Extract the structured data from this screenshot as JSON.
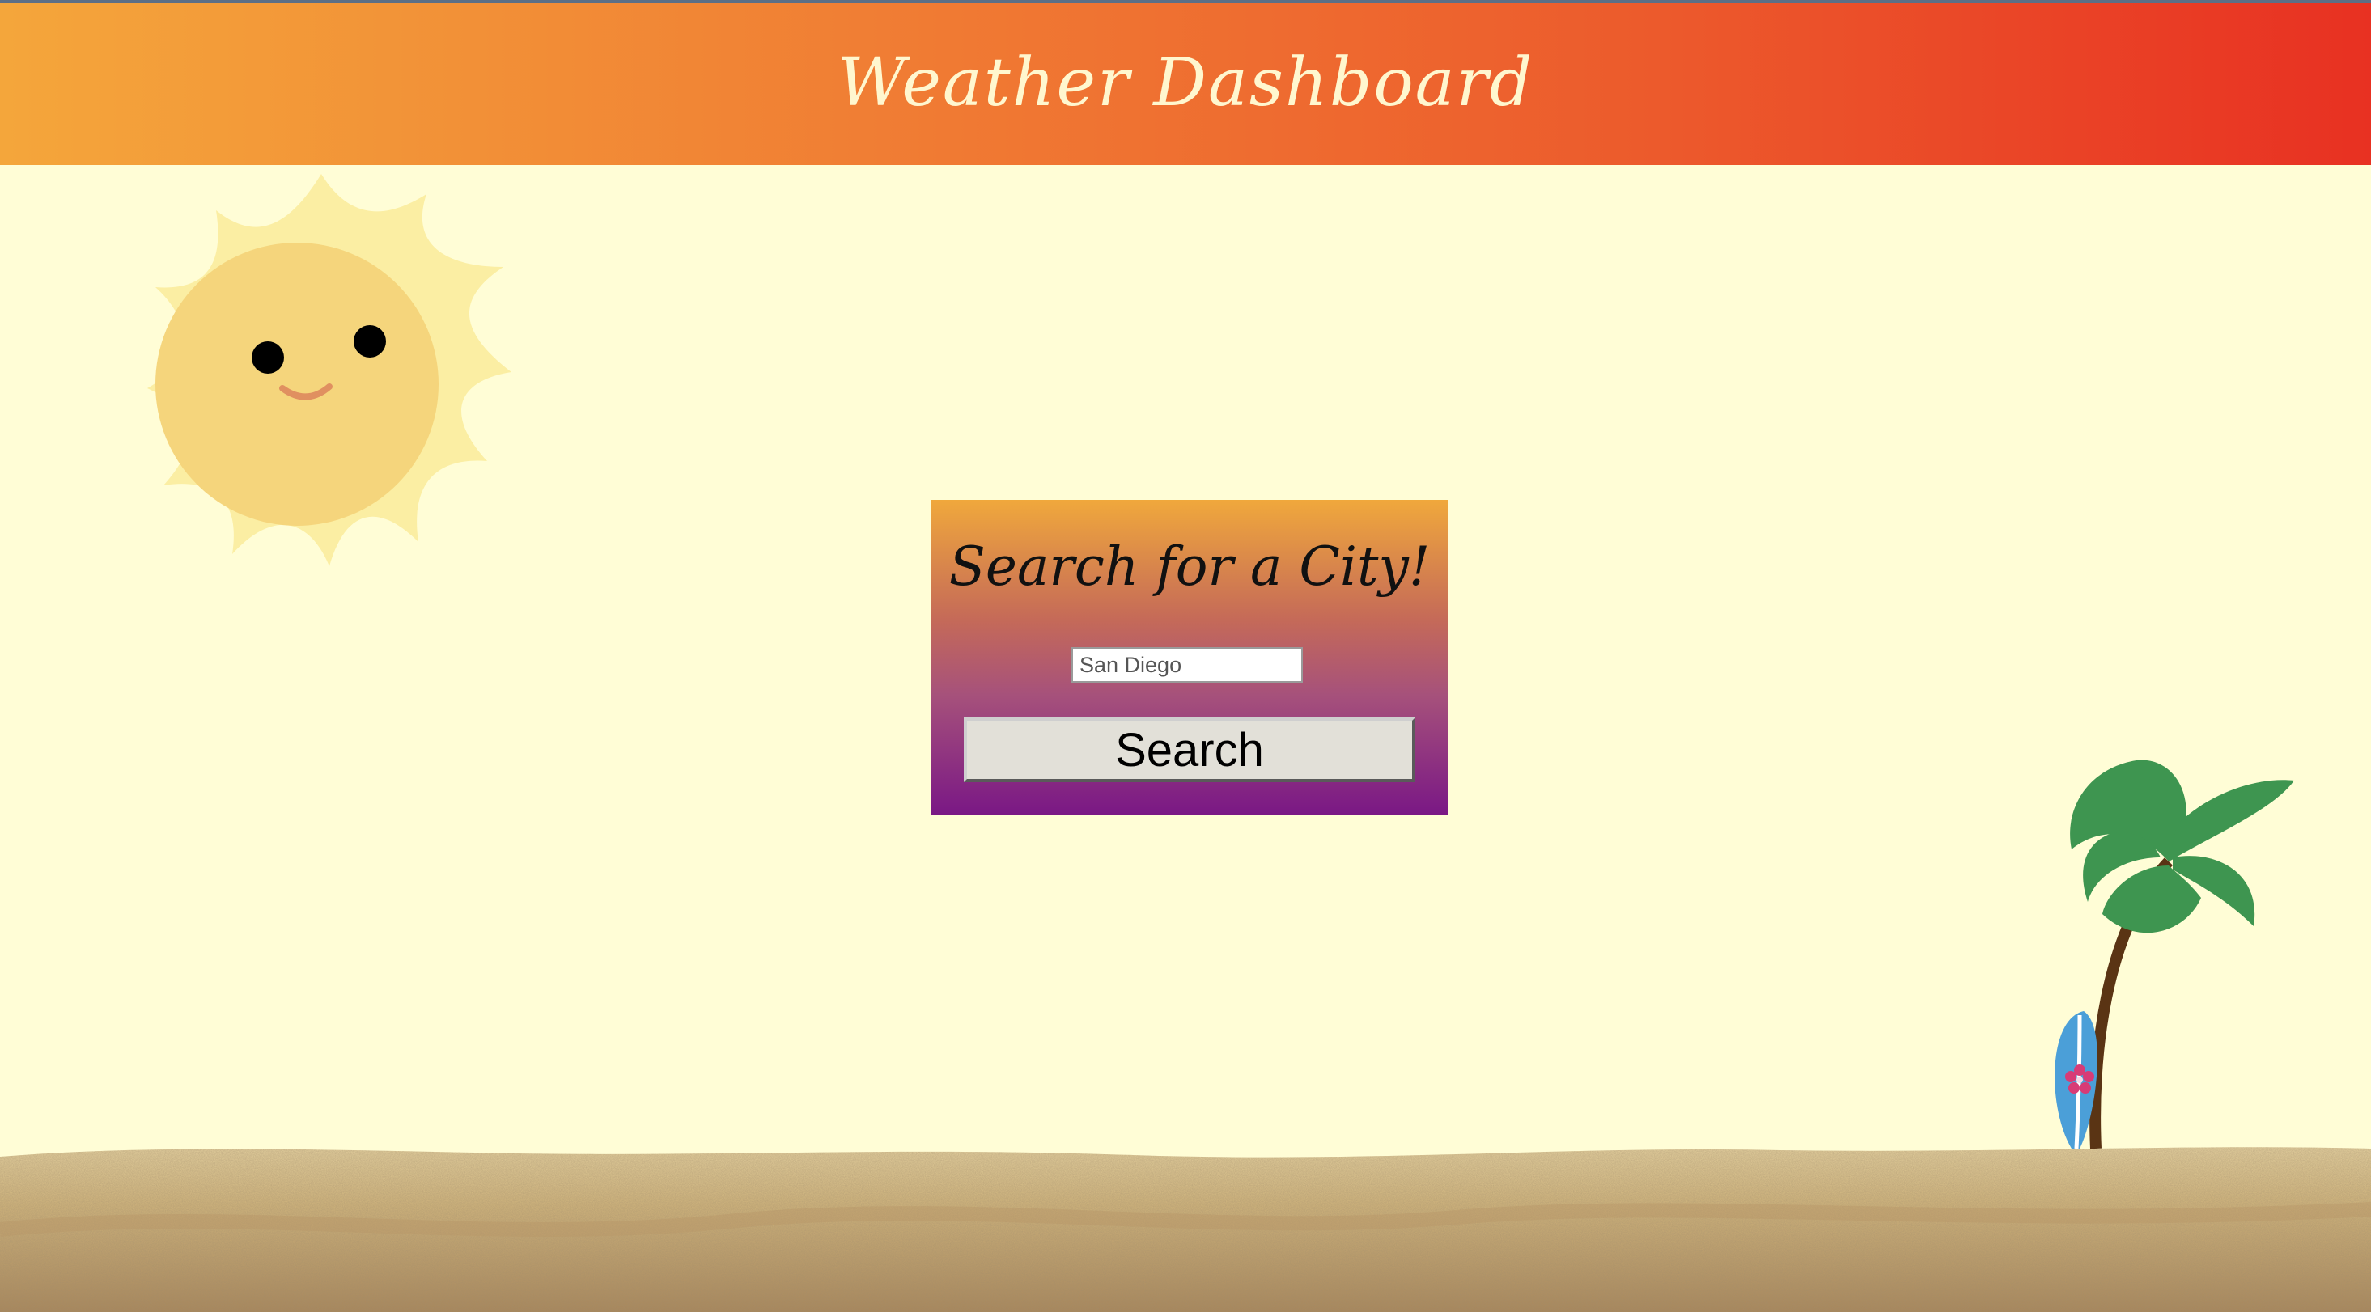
{
  "header": {
    "title": "Weather Dashboard"
  },
  "search_panel": {
    "title": "Search for a City!",
    "input_placeholder": "San Diego",
    "input_value": "",
    "button_label": "Search"
  },
  "colors": {
    "background": "#fffdd6",
    "header_gradient_start": "#f4a63b",
    "header_gradient_end": "#e83122",
    "card_gradient_top": "#f0a83c",
    "card_gradient_bottom": "#7a1885",
    "title_text": "#fff7cf"
  },
  "decorations": {
    "sun": "smiling-sun-icon",
    "palm_tree": "palm-tree-icon",
    "surfboard": "surfboard-icon",
    "sand": "sand-dunes"
  }
}
